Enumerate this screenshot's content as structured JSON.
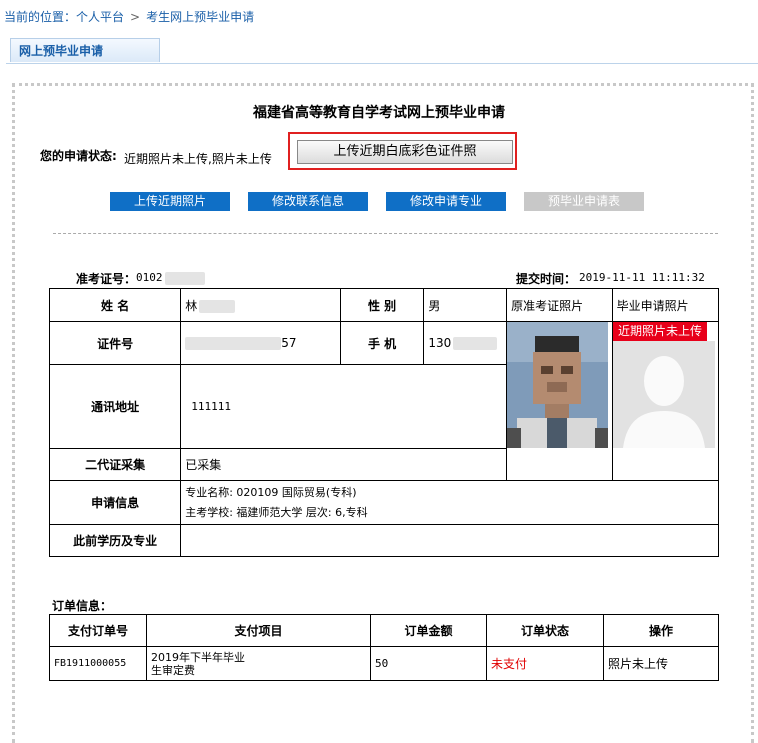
{
  "breadcrumb": {
    "prefix": "当前的位置：",
    "items": [
      "个人平台",
      "考生网上预毕业申请"
    ]
  },
  "tab": {
    "label": "网上预毕业申请"
  },
  "page": {
    "title": "福建省高等教育自学考试网上预毕业申请"
  },
  "status": {
    "label": "您的申请状态:",
    "value": "近期照片未上传,照片未上传",
    "upload_button": "上传近期白底彩色证件照"
  },
  "actions": [
    {
      "label": "上传近期照片",
      "enabled": true
    },
    {
      "label": "修改联系信息",
      "enabled": true
    },
    {
      "label": "修改申请专业",
      "enabled": true
    },
    {
      "label": "预毕业申请表",
      "enabled": false
    }
  ],
  "exam": {
    "id_label": "准考证号：",
    "id_value": "0102",
    "submit_label": "提交时间：",
    "submit_time": "2019-11-11  11:11:32"
  },
  "info": {
    "name_label": "姓  名",
    "name_value": "林",
    "gender_label": "性  别",
    "gender_value": "男",
    "photo_orig_label": "原准考证照片",
    "photo_grad_label": "毕业申请照片",
    "photo_grad_status": "近期照片未上传",
    "id_label": "证件号",
    "id_value_suffix": "57",
    "phone_label": "手  机",
    "phone_value": "130",
    "address_label": "通讯地址",
    "address_value": "111111",
    "second_gen_label": "二代证采集",
    "second_gen_value": "已采集",
    "apply_label": "申请信息",
    "major_line": "专业名称: 020109 国际贸易(专科)",
    "school_line": "主考学校: 福建师范大学  层次: 6,专科",
    "prior_label": "此前学历及专业",
    "prior_value": ""
  },
  "order": {
    "section_label": "订单信息：",
    "headers": [
      "支付订单号",
      "支付项目",
      "订单金额",
      "订单状态",
      "操作"
    ],
    "row": {
      "order_no": "FB1911000055",
      "item_line1": "2019年下半年毕业",
      "item_line2": "生审定费",
      "amount": "50",
      "status": "未支付",
      "operation": "照片未上传"
    }
  },
  "colors": {
    "link": "#1a5fa8",
    "action_blue": "#0f6fc6",
    "disabled": "#c8c8c8",
    "alert_red": "#e8001a"
  }
}
